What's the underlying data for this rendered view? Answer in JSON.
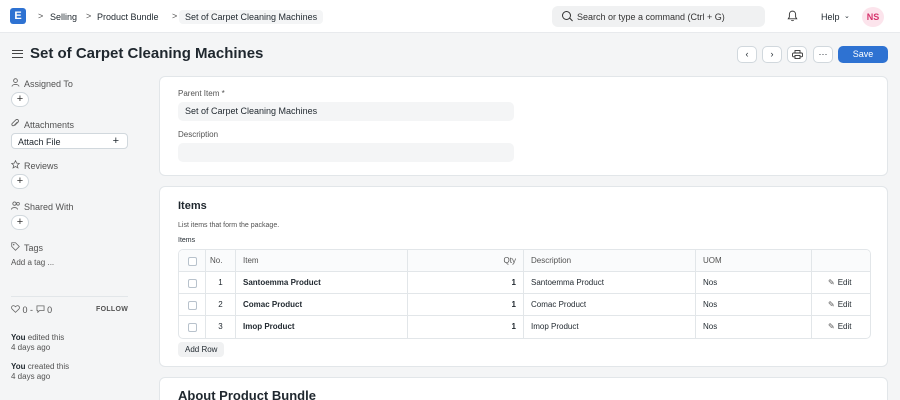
{
  "navbar": {
    "logo_letter": "E",
    "breadcrumbs": [
      {
        "label": "Selling"
      },
      {
        "label": "Product Bundle"
      },
      {
        "label": "Set of Carpet Cleaning Machines"
      }
    ],
    "breadcrumb_sep": ">",
    "search_placeholder": "Search or type a command (Ctrl + G)",
    "help_label": "Help",
    "help_chevron": "⌄",
    "avatar_initials": "NS"
  },
  "header": {
    "title": "Set of Carpet Cleaning Machines",
    "prev_glyph": "‹",
    "next_glyph": "›",
    "print_glyph": "⎙",
    "more_glyph": "···",
    "save_label": "Save"
  },
  "sidebar": {
    "assigned_to": "Assigned To",
    "attachments": "Attachments",
    "attach_file": "Attach File",
    "reviews": "Reviews",
    "shared_with": "Shared With",
    "tags": "Tags",
    "add_tag": "Add a tag ...",
    "plus": "+",
    "likes": "0",
    "comments": "0",
    "stats_sep": "-",
    "follow": "FOLLOW",
    "activity": [
      {
        "who": "You",
        "action": "edited this",
        "when": "4 days ago"
      },
      {
        "who": "You",
        "action": "created this",
        "when": "4 days ago"
      }
    ]
  },
  "form": {
    "parent_item_label": "Parent Item *",
    "parent_item_value": "Set of Carpet Cleaning Machines",
    "description_label": "Description",
    "description_value": ""
  },
  "items_section": {
    "title": "Items",
    "description": "List items that form the package.",
    "table_label": "Items",
    "columns": {
      "no": "No.",
      "item": "Item",
      "qty": "Qty",
      "description": "Description",
      "uom": "UOM"
    },
    "rows": [
      {
        "no": "1",
        "item": "Santoemma Product",
        "qty": "1",
        "description": "Santoemma Product",
        "uom": "Nos",
        "edit": "Edit"
      },
      {
        "no": "2",
        "item": "Comac Product",
        "qty": "1",
        "description": "Comac Product",
        "uom": "Nos",
        "edit": "Edit"
      },
      {
        "no": "3",
        "item": "Imop Product",
        "qty": "1",
        "description": "Imop Product",
        "uom": "Nos",
        "edit": "Edit"
      }
    ],
    "add_row": "Add Row"
  },
  "about_section": {
    "title": "About Product Bundle"
  },
  "colors": {
    "primary": "#2e72d2",
    "background": "#f4f5f6",
    "text": "#1f272e",
    "muted": "#525252",
    "border": "#e2e6e9",
    "avatar_bg": "#fce4ec",
    "avatar_text": "#d6336c"
  },
  "icons": {
    "logo": "app-logo-icon",
    "search": "search-icon",
    "bell": "bell-icon",
    "menu": "hamburger-icon",
    "assigned": "user-icon",
    "attachments": "paperclip-icon",
    "reviews": "star-icon",
    "shared": "users-icon",
    "tags": "tag-icon",
    "like": "heart-icon",
    "comment": "comment-icon",
    "edit": "pencil-icon"
  }
}
